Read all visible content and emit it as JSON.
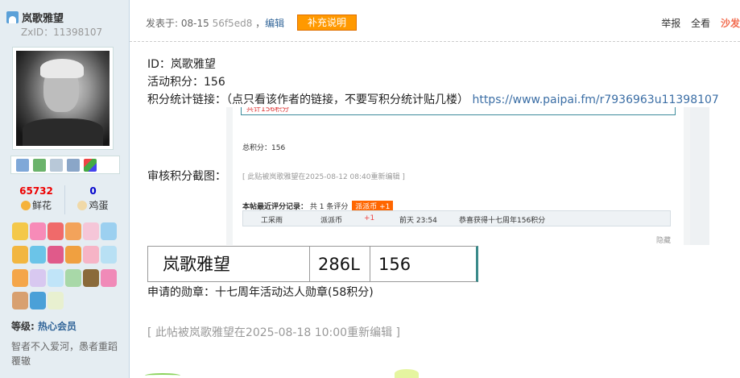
{
  "user": {
    "username": "岚歌雅望",
    "zxid": "ZxID：11398107",
    "flowers_count": "65732",
    "flowers_label": "鲜花",
    "eggs_count": "0",
    "eggs_label": "鸡蛋",
    "level_label": "等级:",
    "level_value": "热心会员",
    "signature": "智者不入爱河，愚者重蹈覆辙"
  },
  "post_header": {
    "posted_at": "发表于: 08-15",
    "hash": "56f5ed8",
    "edit_link": "编辑",
    "supplement_button": "补充说明",
    "report": "举报",
    "view_all": "全看",
    "sofa": "沙发"
  },
  "content": {
    "id_line": "ID：岚歌雅望",
    "points_line": "活动积分：156",
    "link_label": "积分统计链接：（点只看该作者的链接，不要写积分统计贴几楼）",
    "link_url": "https://www.paipai.fm/r7936963u11398107",
    "review_label": "审核积分截图：",
    "medal_apply": "申请的勋章：十七周年活动达人勋章(58积分)",
    "edit_note": "[ 此帖被岚歌雅望在2025-08-18 10:00重新编辑 ]"
  },
  "screenshot": {
    "top_text": "共计156积分",
    "total_points": "总积分：156",
    "edit_text": "[ 此贴被岚歌雅望在2025-08-12 08:40重新编辑 ]",
    "rating_label": "本帖最近评分记录：",
    "rating_count": "共 1 条评分",
    "rating_tag": "派派币 +1",
    "row_user": "工采雨",
    "row_type": "派派币",
    "row_value": "+1",
    "row_time": "前天 23:54",
    "row_reason": "恭喜获得十七周年156积分",
    "hide": "隐藏"
  },
  "floor_table": {
    "name": "岚歌雅望",
    "floor": "286L",
    "points": "156"
  },
  "colors": {
    "sidebar_bg": "#e5edf2",
    "supplement_button": "#ff9900",
    "link": "#3b6ea5",
    "flowers": "#ee0000",
    "eggs": "#0000cc"
  },
  "icons": [
    "user-icon",
    "mail-icon",
    "add-friend-icon",
    "search-icon",
    "profile-icon",
    "blocks-icon",
    "flower-icon",
    "egg-icon"
  ]
}
